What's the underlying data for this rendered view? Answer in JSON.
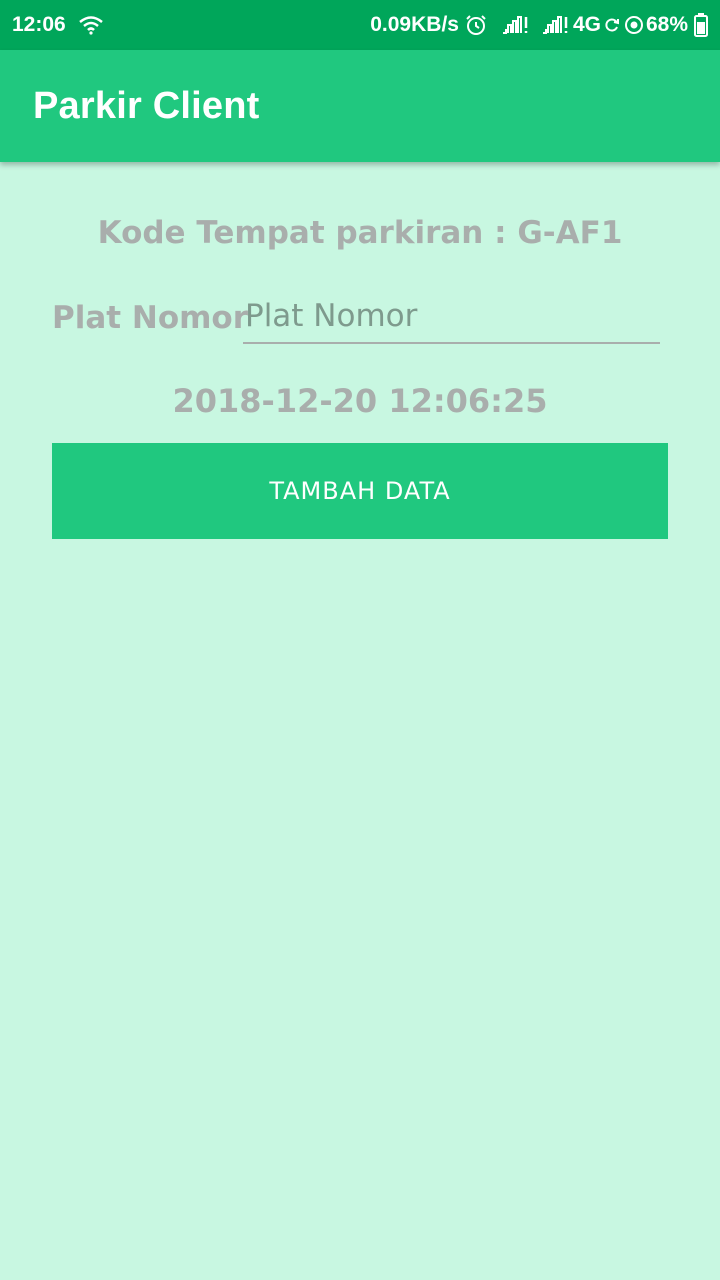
{
  "status_bar": {
    "time": "12:06",
    "net_speed": "0.09KB/s",
    "network": "4G",
    "battery": "68%",
    "icons": [
      "wifi-icon",
      "alarm-icon",
      "signal-icon",
      "signal-icon",
      "sync-icon",
      "location-icon",
      "battery-icon"
    ]
  },
  "app_bar": {
    "title": "Parkir Client"
  },
  "form": {
    "kode_text": "Kode Tempat parkiran : G-AF1",
    "plat_label": "Plat Nomor",
    "plat_placeholder": "Plat Nomor",
    "plat_value": "",
    "datetime": "2018-12-20 12:06:25",
    "submit_label": "TAMBAH DATA"
  },
  "colors": {
    "status_bar": "#00a65a",
    "app_bar": "#20c87f",
    "background": "#c8f7e1",
    "button": "#20c87f",
    "muted_text": "#a9aeac"
  }
}
